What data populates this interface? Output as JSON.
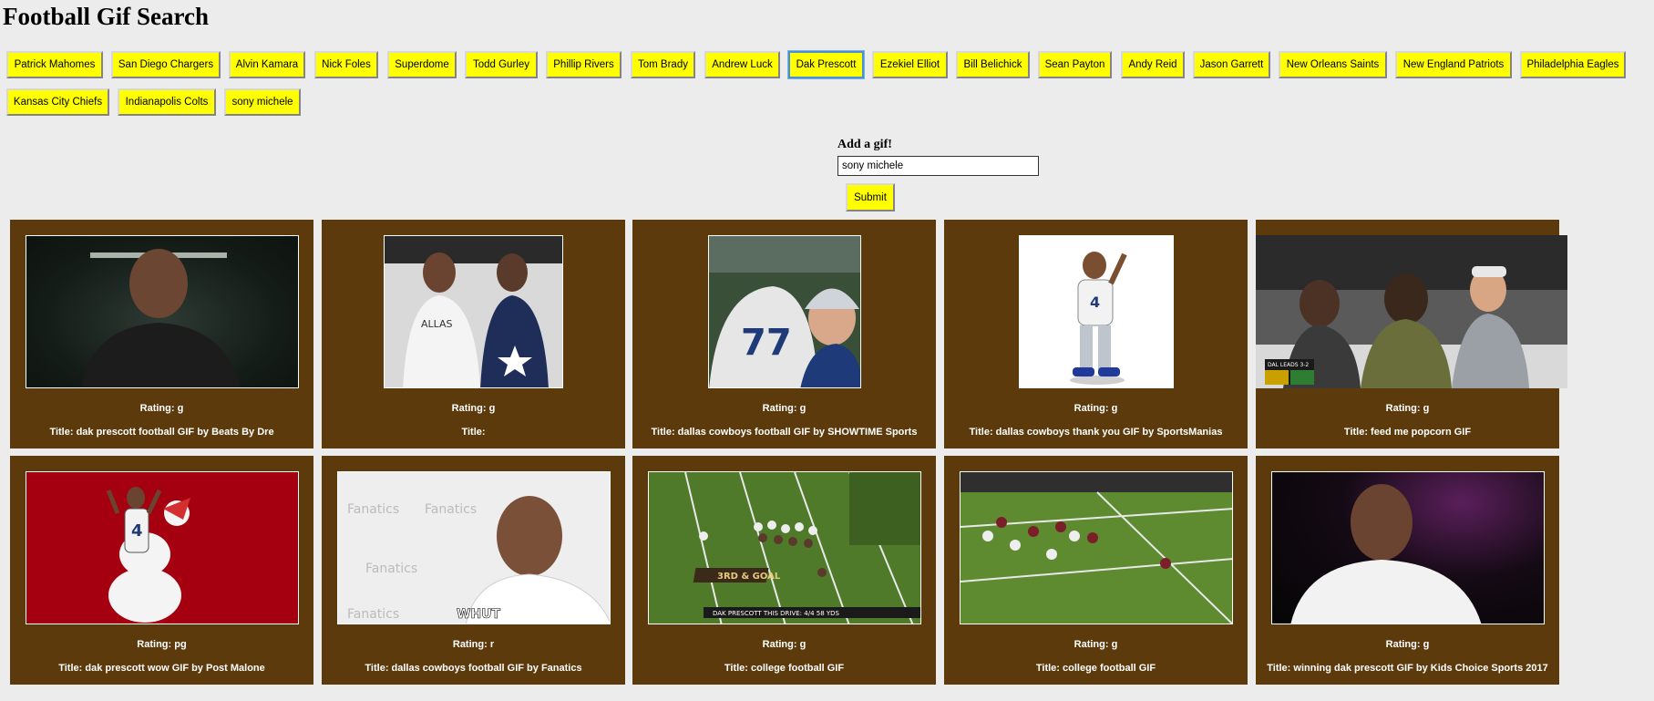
{
  "header": {
    "title": "Football Gif Search"
  },
  "topics": [
    "Patrick Mahomes",
    "San Diego Chargers",
    "Alvin Kamara",
    "Nick Foles",
    "Superdome",
    "Todd Gurley",
    "Phillip Rivers",
    "Tom Brady",
    "Andrew Luck",
    "Dak Prescott",
    "Ezekiel Elliot",
    "Bill Belichick",
    "Sean Payton",
    "Andy Reid",
    "Jason Garrett",
    "New Orleans Saints",
    "New England Patriots",
    "Philadelphia Eagles",
    "Kansas City Chiefs",
    "Indianapolis Colts",
    "sony michele"
  ],
  "form": {
    "label": "Add a gif!",
    "input_value": "sony michele",
    "submit_label": "Submit"
  },
  "colors": {
    "button_bg": "#ffff00",
    "card_bg": "#5c3a0c",
    "page_bg": "#ececec"
  },
  "results": [
    {
      "rating": "Rating: g",
      "title": "Title: dak prescott football GIF by Beats By Dre"
    },
    {
      "rating": "Rating: g",
      "title": "Title:"
    },
    {
      "rating": "Rating: g",
      "title": "Title: dallas cowboys football GIF by SHOWTIME Sports"
    },
    {
      "rating": "Rating: g",
      "title": "Title: dallas cowboys thank you GIF by SportsManias"
    },
    {
      "rating": "Rating: g",
      "title": "Title: feed me popcorn GIF"
    },
    {
      "rating": "Rating: pg",
      "title": "Title: dak prescott wow GIF by Post Malone"
    },
    {
      "rating": "Rating: r",
      "title": "Title: dallas cowboys football GIF by Fanatics"
    },
    {
      "rating": "Rating: g",
      "title": "Title: college football GIF"
    },
    {
      "rating": "Rating: g",
      "title": "Title: college football GIF"
    },
    {
      "rating": "Rating: g",
      "title": "Title: winning dak prescott GIF by Kids Choice Sports 2017"
    }
  ],
  "thumb_text": {
    "jersey_77": "77",
    "jersey_4": "4",
    "scoreboard": "DAL LEADS 3-2",
    "fanatics": "Fanatics",
    "whut": "WHUT",
    "scorebug": "DAK PRESCOTT THIS DRIVE: 4/4 58 YDS",
    "goal_line": "3RD & GOAL",
    "jersey_dallas": "ALLAS"
  }
}
